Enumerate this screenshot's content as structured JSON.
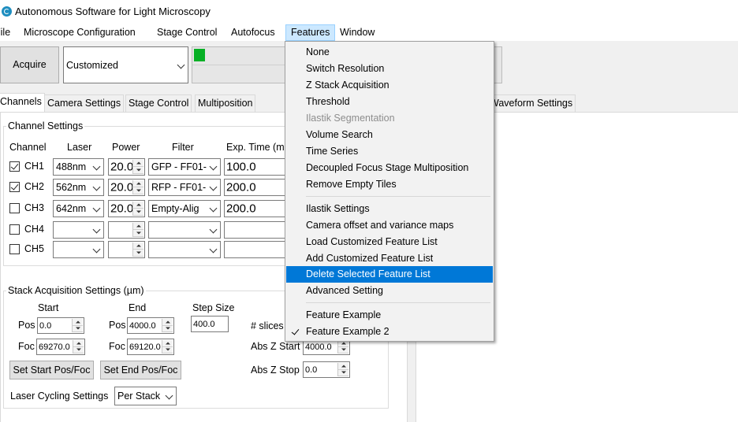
{
  "window": {
    "title": "Autonomous Software for Light Microscopy"
  },
  "menubar": {
    "items": [
      "File",
      "Microscope Configuration",
      "Stage Control",
      "Autofocus",
      "Features",
      "Window"
    ]
  },
  "toolbar": {
    "acquire_label": "Acquire",
    "mode_value": "Customized",
    "progress_fraction": 0.12
  },
  "tabs": [
    "Channels",
    "Camera Settings",
    "Stage Control",
    "Multiposition",
    "Waveform Settings"
  ],
  "channel_settings": {
    "title": "Channel Settings",
    "headers": [
      "Channel",
      "Laser",
      "Power",
      "Filter",
      "Exp. Time (m"
    ],
    "rows": [
      {
        "checked": true,
        "name": "CH1",
        "laser": "488nm",
        "power": "20.0",
        "filter": "GFP - FF01-",
        "exp": "100.0"
      },
      {
        "checked": true,
        "name": "CH2",
        "laser": "562nm",
        "power": "20.0",
        "filter": "RFP - FF01-",
        "exp": "200.0"
      },
      {
        "checked": false,
        "name": "CH3",
        "laser": "642nm",
        "power": "20.0",
        "filter": "Empty-Alig",
        "exp": "200.0"
      },
      {
        "checked": false,
        "name": "CH4",
        "laser": "",
        "power": "",
        "filter": "",
        "exp": ""
      },
      {
        "checked": false,
        "name": "CH5",
        "laser": "",
        "power": "",
        "filter": "",
        "exp": ""
      }
    ]
  },
  "stack": {
    "title": "Stack Acquisition Settings (µm)",
    "start_label": "Start",
    "end_label": "End",
    "step_label": "Step Size",
    "step_value": "400.0",
    "pos_label": "Pos",
    "foc_label": "Foc",
    "start_pos": "0.0",
    "start_foc": "69270.0",
    "end_pos": "4000.0",
    "end_foc": "69120.0",
    "slices_label": "# slices",
    "abs_z_start_label": "Abs Z Start",
    "abs_z_start_value": "4000.0",
    "abs_z_stop_label": "Abs Z Stop",
    "abs_z_stop_value": "0.0",
    "set_start_label": "Set Start Pos/Foc",
    "set_end_label": "Set End Pos/Foc",
    "laser_cycling_label": "Laser Cycling Settings",
    "laser_cycling_value": "Per Stack"
  },
  "features_menu": {
    "items": [
      {
        "label": "None"
      },
      {
        "label": "Switch Resolution"
      },
      {
        "label": "Z Stack Acquisition"
      },
      {
        "label": "Threshold"
      },
      {
        "label": "Ilastik Segmentation",
        "disabled": true
      },
      {
        "label": "Volume Search"
      },
      {
        "label": "Time Series"
      },
      {
        "label": "Decoupled Focus Stage Multiposition"
      },
      {
        "label": "Remove Empty Tiles"
      },
      {
        "label": "Ilastik Settings"
      },
      {
        "label": "Camera offset and variance maps"
      },
      {
        "label": "Load Customized Feature List"
      },
      {
        "label": "Add Customized Feature List"
      },
      {
        "label": "Delete Selected Feature List",
        "highlighted": true
      },
      {
        "label": "Advanced Setting"
      },
      {
        "label": "Feature Example"
      },
      {
        "label": "Feature Example 2",
        "checked": true
      }
    ]
  },
  "colors": {
    "progress_green": "#06b025",
    "menu_highlight": "#0078d7",
    "menubar_active": "#cce8ff"
  }
}
